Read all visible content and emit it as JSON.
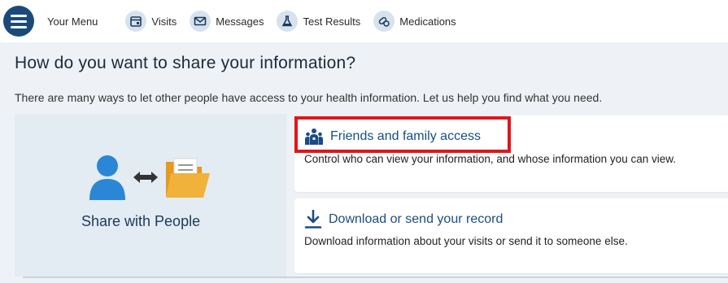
{
  "nav": {
    "menu_label": "Your Menu",
    "visits_label": "Visits",
    "messages_label": "Messages",
    "test_results_label": "Test Results",
    "medications_label": "Medications"
  },
  "page": {
    "heading": "How do you want to share your information?",
    "intro": "There are many ways to let other people have access to your health information. Let us help you find what you need."
  },
  "share_panel": {
    "label": "Share with People"
  },
  "cards": [
    {
      "title": "Friends and family access",
      "description": "Control who can view your information, and whose information you can view."
    },
    {
      "title": "Download or send your record",
      "description": "Download information about your visits or send it to someone else."
    }
  ],
  "colors": {
    "accent": "#1a4c84",
    "highlight": "#e3141b",
    "person": "#2b86d6",
    "folder": "#f0b23a"
  }
}
